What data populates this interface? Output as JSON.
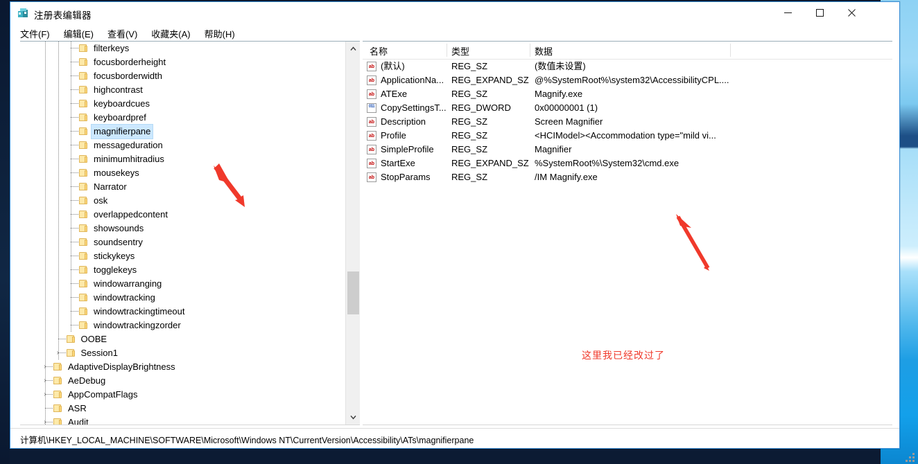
{
  "window": {
    "title": "注册表编辑器",
    "icon": "registry-editor-icon",
    "controls": {
      "minimize": "—",
      "maximize": "□",
      "close": "✕"
    }
  },
  "menubar": {
    "items": [
      {
        "label": "文件(F)"
      },
      {
        "label": "编辑(E)"
      },
      {
        "label": "查看(V)"
      },
      {
        "label": "收藏夹(A)"
      },
      {
        "label": "帮助(H)"
      }
    ]
  },
  "tree": {
    "items": [
      {
        "label": "filterkeys",
        "depth": 2,
        "expander": "",
        "selected": false
      },
      {
        "label": "focusborderheight",
        "depth": 2,
        "expander": "",
        "selected": false
      },
      {
        "label": "focusborderwidth",
        "depth": 2,
        "expander": "",
        "selected": false
      },
      {
        "label": "highcontrast",
        "depth": 2,
        "expander": "",
        "selected": false
      },
      {
        "label": "keyboardcues",
        "depth": 2,
        "expander": "",
        "selected": false
      },
      {
        "label": "keyboardpref",
        "depth": 2,
        "expander": "",
        "selected": false
      },
      {
        "label": "magnifierpane",
        "depth": 2,
        "expander": "",
        "selected": true
      },
      {
        "label": "messageduration",
        "depth": 2,
        "expander": "",
        "selected": false
      },
      {
        "label": "minimumhitradius",
        "depth": 2,
        "expander": "",
        "selected": false
      },
      {
        "label": "mousekeys",
        "depth": 2,
        "expander": "",
        "selected": false
      },
      {
        "label": "Narrator",
        "depth": 2,
        "expander": "",
        "selected": false
      },
      {
        "label": "osk",
        "depth": 2,
        "expander": "",
        "selected": false
      },
      {
        "label": "overlappedcontent",
        "depth": 2,
        "expander": "",
        "selected": false
      },
      {
        "label": "showsounds",
        "depth": 2,
        "expander": "",
        "selected": false
      },
      {
        "label": "soundsentry",
        "depth": 2,
        "expander": "",
        "selected": false
      },
      {
        "label": "stickykeys",
        "depth": 2,
        "expander": "",
        "selected": false
      },
      {
        "label": "togglekeys",
        "depth": 2,
        "expander": "",
        "selected": false
      },
      {
        "label": "windowarranging",
        "depth": 2,
        "expander": "",
        "selected": false
      },
      {
        "label": "windowtracking",
        "depth": 2,
        "expander": "",
        "selected": false
      },
      {
        "label": "windowtrackingtimeout",
        "depth": 2,
        "expander": "",
        "selected": false
      },
      {
        "label": "windowtrackingzorder",
        "depth": 2,
        "expander": "",
        "selected": false
      },
      {
        "label": "OOBE",
        "depth": 1,
        "expander": "",
        "selected": false
      },
      {
        "label": "Session1",
        "depth": 1,
        "expander": "›",
        "selected": false
      },
      {
        "label": "AdaptiveDisplayBrightness",
        "depth": 0,
        "expander": "›",
        "selected": false
      },
      {
        "label": "AeDebug",
        "depth": 0,
        "expander": "›",
        "selected": false
      },
      {
        "label": "AppCompatFlags",
        "depth": 0,
        "expander": "›",
        "selected": false
      },
      {
        "label": "ASR",
        "depth": 0,
        "expander": "",
        "selected": false
      },
      {
        "label": "Audit",
        "depth": 0,
        "expander": "›",
        "selected": false
      }
    ],
    "scrollbar": {
      "up_arrow": "∧",
      "down_arrow": "∨"
    }
  },
  "list": {
    "columns": [
      {
        "label": "名称"
      },
      {
        "label": "类型"
      },
      {
        "label": "数据"
      }
    ],
    "rows": [
      {
        "icon": "string-value-icon",
        "icon_text": "ab",
        "name": "(默认)",
        "type": "REG_SZ",
        "data": "(数值未设置)"
      },
      {
        "icon": "string-value-icon",
        "icon_text": "ab",
        "name": "ApplicationNa...",
        "type": "REG_EXPAND_SZ",
        "data": "@%SystemRoot%\\system32\\AccessibilityCPL...."
      },
      {
        "icon": "string-value-icon",
        "icon_text": "ab",
        "name": "ATExe",
        "type": "REG_SZ",
        "data": "Magnify.exe"
      },
      {
        "icon": "dword-value-icon",
        "icon_text": "011",
        "name": "CopySettingsT...",
        "type": "REG_DWORD",
        "data": "0x00000001 (1)"
      },
      {
        "icon": "string-value-icon",
        "icon_text": "ab",
        "name": "Description",
        "type": "REG_SZ",
        "data": "Screen Magnifier"
      },
      {
        "icon": "string-value-icon",
        "icon_text": "ab",
        "name": "Profile",
        "type": "REG_SZ",
        "data": "<HCIModel><Accommodation type=\"mild vi..."
      },
      {
        "icon": "string-value-icon",
        "icon_text": "ab",
        "name": "SimpleProfile",
        "type": "REG_SZ",
        "data": "Magnifier"
      },
      {
        "icon": "string-value-icon",
        "icon_text": "ab",
        "name": "StartExe",
        "type": "REG_EXPAND_SZ",
        "data": "%SystemRoot%\\System32\\cmd.exe"
      },
      {
        "icon": "string-value-icon",
        "icon_text": "ab",
        "name": "StopParams",
        "type": "REG_SZ",
        "data": "/IM Magnify.exe"
      }
    ]
  },
  "annotations": {
    "note": "这里我已经改过了",
    "color": "#f0392b",
    "arrows": [
      {
        "name": "arrow-to-magnifierpane"
      },
      {
        "name": "arrow-to-startexe-data"
      }
    ]
  },
  "statusbar": {
    "path": "计算机\\HKEY_LOCAL_MACHINE\\SOFTWARE\\Microsoft\\Windows NT\\CurrentVersion\\Accessibility\\ATs\\magnifierpane"
  }
}
